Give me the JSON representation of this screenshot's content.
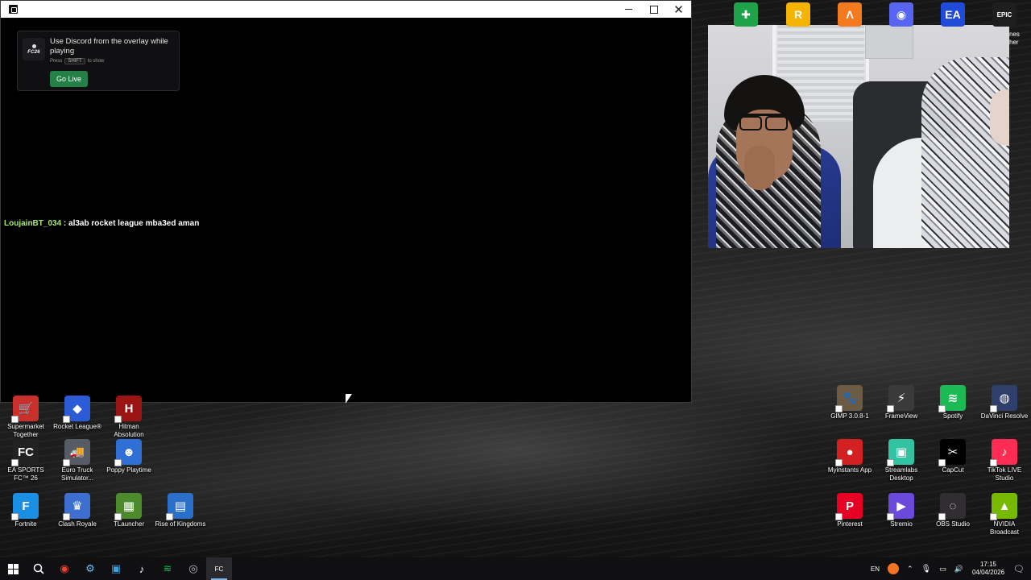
{
  "game_window": {
    "overlay": {
      "game_logo_text": "FC26",
      "title": "Use Discord from the overlay while playing",
      "hint_prefix": "Press",
      "hint_key": "SHIFT",
      "hint_suffix": "to show",
      "go_live_label": "Go Live",
      "button_color": "#248046"
    },
    "chat": {
      "username": "LoujainBT_034",
      "separator": " : ",
      "message": "al3ab rocket league mba3ed aman"
    }
  },
  "top_icons": [
    {
      "name": "game-controller",
      "glyph": "✚",
      "color": "#1fa34a"
    },
    {
      "name": "rockstar",
      "glyph": "R",
      "color": "#f4b400"
    },
    {
      "name": "launcher",
      "glyph": "Λ",
      "color": "#f47a20"
    },
    {
      "name": "discord",
      "glyph": "◉",
      "color": "#5865f2"
    },
    {
      "name": "ea",
      "glyph": "EA",
      "color": "#1f4bd8"
    },
    {
      "name": "epic-games",
      "glyph": "EPIC",
      "color": "#1e1e1e"
    }
  ],
  "cut_label": "nes\nher",
  "left_icons": [
    {
      "label": "Supermarket Together",
      "glyph": "🛒",
      "color": "#c9302c"
    },
    {
      "label": "Rocket League®",
      "glyph": "◆",
      "color": "#2b5bd7"
    },
    {
      "label": "Hitman Absolution",
      "glyph": "H",
      "color": "#9b1414"
    },
    {
      "label": "EA SPORTS FC™ 26",
      "glyph": "FC",
      "color": "#222222"
    },
    {
      "label": "Euro Truck Simulator...",
      "glyph": "🚚",
      "color": "#555c66"
    },
    {
      "label": "Poppy Playtime",
      "glyph": "☻",
      "color": "#2f6fd6"
    },
    {
      "label": "Fortnite",
      "glyph": "F",
      "color": "#1a8fe3"
    },
    {
      "label": "Clash Royale",
      "glyph": "♛",
      "color": "#3d6fd1"
    },
    {
      "label": "TLauncher",
      "glyph": "▦",
      "color": "#4c8a2c"
    },
    {
      "label": "Rise of Kingdoms",
      "glyph": "▤",
      "color": "#2a6fc9"
    }
  ],
  "right_icons": [
    {
      "label": "GIMP 3.0.8-1",
      "glyph": "🐾",
      "color": "#6b5a44"
    },
    {
      "label": "FrameView",
      "glyph": "⚡",
      "color": "#3a3a3a"
    },
    {
      "label": "Spotify",
      "glyph": "≋",
      "color": "#1db954"
    },
    {
      "label": "DaVinci Resolve",
      "glyph": "◍",
      "color": "#2f3f6b"
    },
    {
      "label": "Myinstants App",
      "glyph": "●",
      "color": "#d32020"
    },
    {
      "label": "Streamlabs Desktop",
      "glyph": "▣",
      "color": "#31c3a2"
    },
    {
      "label": "CapCut",
      "glyph": "✂",
      "color": "#000000"
    },
    {
      "label": "TikTok LIVE Studio",
      "glyph": "♪",
      "color": "#fe2c55"
    },
    {
      "label": "Pinterest",
      "glyph": "P",
      "color": "#e60023"
    },
    {
      "label": "Stremio",
      "glyph": "▶",
      "color": "#6c4ad9"
    },
    {
      "label": "OBS Studio",
      "glyph": "◌",
      "color": "#302e31"
    },
    {
      "label": "NVIDIA Broadcast",
      "glyph": "▲",
      "color": "#76b900"
    }
  ],
  "taskbar": {
    "apps": [
      {
        "name": "chrome",
        "glyph": "◉",
        "color": "#ea4335"
      },
      {
        "name": "steam",
        "glyph": "⚙",
        "color": "#66c0f4"
      },
      {
        "name": "file-explorer",
        "glyph": "▣",
        "color": "#3aa0e0"
      },
      {
        "name": "tiktok",
        "glyph": "♪",
        "color": "#ffffff"
      },
      {
        "name": "spotify",
        "glyph": "≋",
        "color": "#1db954"
      },
      {
        "name": "ea-fc",
        "glyph": "◎",
        "color": "#bbbbbb"
      },
      {
        "name": "fc26-game",
        "glyph": "FC",
        "color": "#ffffff"
      }
    ],
    "language": "EN",
    "time": "17:15",
    "date": "04/04/2026"
  }
}
